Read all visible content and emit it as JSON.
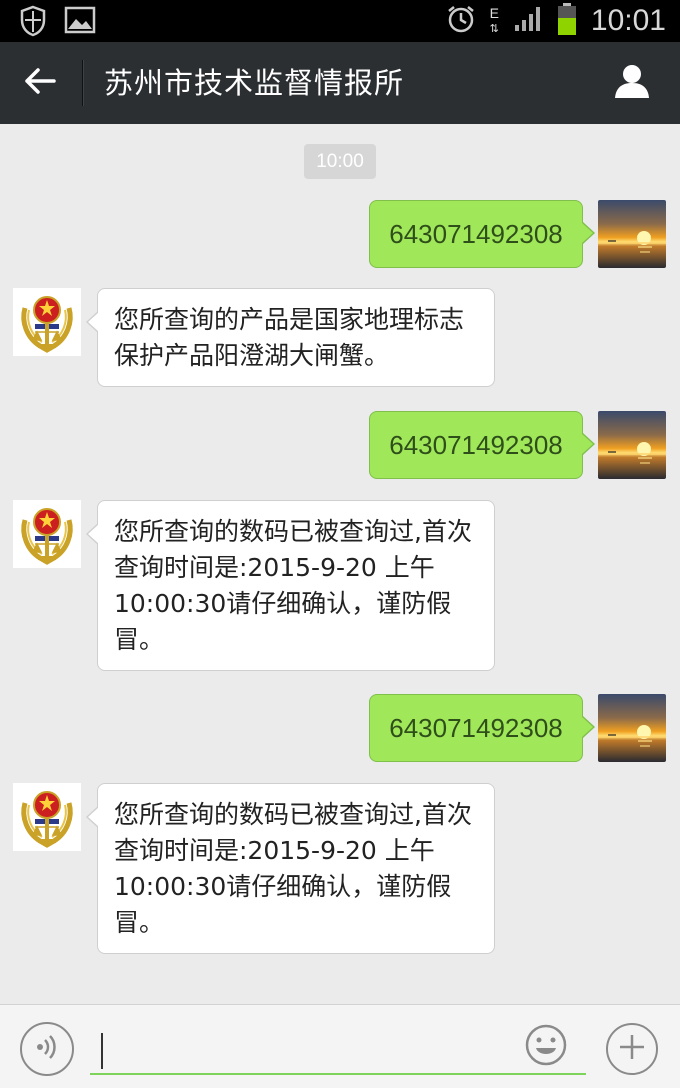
{
  "status_bar": {
    "time": "10:01",
    "network_type": "E",
    "icons": [
      "shield-icon",
      "image-icon",
      "alarm-icon",
      "signal-icon",
      "battery-icon"
    ]
  },
  "header": {
    "title": "苏州市技术监督情报所",
    "back_icon": "arrow-left-icon",
    "profile_icon": "person-icon"
  },
  "chat": {
    "timestamp": "10:00",
    "messages": [
      {
        "from": "me",
        "text": "643071492308"
      },
      {
        "from": "bot",
        "text": "您所查询的产品是国家地理标志保护产品阳澄湖大闸蟹。"
      },
      {
        "from": "me",
        "text": "643071492308"
      },
      {
        "from": "bot",
        "text": "您所查询的数码已被查询过,首次查询时间是:2015-9-20 上午10:00:30请仔细确认，谨防假冒。"
      },
      {
        "from": "me",
        "text": "643071492308"
      },
      {
        "from": "bot",
        "text": "您所查询的数码已被查询过,首次查询时间是:2015-9-20 上午10:00:30请仔细确认，谨防假冒。"
      }
    ]
  },
  "input_bar": {
    "text_value": "",
    "placeholder": "",
    "voice_icon": "voice-icon",
    "emoji_icon": "emoji-icon",
    "plus_icon": "plus-icon"
  },
  "colors": {
    "status_bar": "#000000",
    "header": "#2b2f32",
    "chat_background": "#ebebeb",
    "my_bubble": "#a0e75a",
    "bot_bubble": "#ffffff",
    "input_underline": "#7ed35a",
    "battery": "#8fd400"
  }
}
